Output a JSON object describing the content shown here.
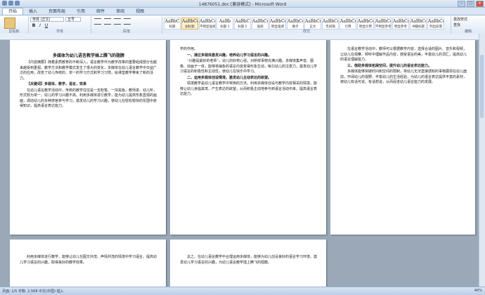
{
  "window": {
    "title": "14876051.doc [兼容模式] - Microsoft Word",
    "close_glyph": "✕",
    "max_glyph": "□",
    "min_glyph": "–"
  },
  "tabs": [
    "开始",
    "插入",
    "页面布局",
    "引用",
    "邮件",
    "审阅",
    "视图"
  ],
  "ribbon": {
    "font_name": "宋体 (正文)",
    "font_size": "五号",
    "bold": "B",
    "italic": "I",
    "underline": "U",
    "groups": {
      "clipboard": "剪贴板",
      "font": "字体",
      "paragraph": "段落",
      "styles": "样式",
      "editing": "编辑"
    },
    "styles": [
      {
        "preview": "AaBbC",
        "label": "标题",
        "selected": false
      },
      {
        "preview": "AaBbCcD",
        "label": "副标题",
        "selected": true
      },
      {
        "preview": "AaBbCcD",
        "label": "不明显强调",
        "selected": false
      },
      {
        "preview": "AaBb",
        "label": "标题 1",
        "selected": false
      },
      {
        "preview": "AaBbC",
        "label": "标题 2",
        "selected": false
      },
      {
        "preview": "AaBbCcD",
        "label": "强调",
        "selected": false
      },
      {
        "preview": "AaBbCcD",
        "label": "明显强调",
        "selected": false
      },
      {
        "preview": "AaBbCcD",
        "label": "要点",
        "selected": false
      },
      {
        "preview": "AaBbCcD",
        "label": "正文",
        "selected": false
      },
      {
        "preview": "AaBbCcD",
        "label": "无间隔",
        "selected": false
      },
      {
        "preview": "AaBbCcD",
        "label": "引用",
        "selected": false
      },
      {
        "preview": "AaBbCcD",
        "label": "明显引用",
        "selected": false
      },
      {
        "preview": "AaBbCcD",
        "label": "不明显参考",
        "selected": false
      },
      {
        "preview": "AaBbCcD",
        "label": "明显参考",
        "selected": false
      },
      {
        "preview": "AaBbCcD",
        "label": "书籍标题",
        "selected": false
      },
      {
        "preview": "AaBbCcD",
        "label": "列出段落",
        "selected": false
      }
    ],
    "change_styles": "更改样式",
    "editing_items": [
      "查找",
      "替换",
      "选择"
    ]
  },
  "pages": [
    {
      "title": "多媒体为幼儿语言教学插上腾飞的翅膀",
      "paragraphs": [
        "【内容摘要】随着素质教育的不断深入，语言教学作为教学改革的重要组成部分也越来越受到重视。教学方法和教学模式发生了很大的变化，多媒体在幼儿语言教学中日益广泛的应用，改变了幼儿传统的、单一的学习方式和学习习惯，给课堂教学带来了新的活力。",
        "【关键词】多媒体，教学，语言，效果",
        "在幼儿语言教学活动中，传统的教学往往是一支粉笔、一块黑板，教师讲、幼儿听，形式较为单一，幼儿的学习兴趣不高。利用多媒体进行教学，能为幼儿提供形象直观的画面，调动幼儿的多种感官参与学习，激发幼儿的学习兴趣，使幼儿在轻松愉快的氛围中获得知识，提高语言表达能力。"
      ]
    },
    {
      "paragraphs": [
        "学的作用。",
        "一、通过多媒体激发兴趣，培养幼儿学习语言的兴趣。",
        "“兴趣是最好的老师”，幼儿的好奇心强，对新鲜事物充满兴趣。多媒体集声音、图像、动画于一体，能够将抽象的语言内容变得形象生动，吸引幼儿的注意力，激发幼儿学习语言的积极性和主动性，使幼儿在快乐中学习。",
        "二、运用多媒体创设情境，激发幼儿主动表达的欲望。",
        "情境教学是幼儿语言教学中常用的方法。利用多媒体创设与教学内容相关的情境，能够让幼儿身临其境，产生表达的欲望，从而积极主动地参与到语言活动中来，提高语言表达能力。"
      ]
    },
    {
      "paragraphs": [
        "在语言教学活动中，教师可以根据教学内容，选择合适的图片、音乐和视频，让幼儿在观察、倾听中理解作品内容，感受语言的美，丰富幼儿的词汇，提高幼儿的语言理解能力。",
        "三、借助多媒体拓展空间，提升幼儿的语言表达能力。",
        "多媒体能够突破时间和空间的限制，将幼儿无法直接感知的事物展现在幼儿面前，开阔幼儿的视野，丰富幼儿的生活经验，为幼儿的语言表达提供丰富的素材，使幼儿有话可说、有话想说，从而促进幼儿语言能力的发展。"
      ]
    },
    {
      "paragraphs": [
        "利用多媒体进行教学，能够让幼儿在图文并茂、声情并茂的情境中学习语言，提高幼儿学习语言的兴趣，取得良好的教学效果。"
      ]
    },
    {
      "paragraphs": [
        "总之，在幼儿语言教学中合理运用多媒体，能够为幼儿创设良好的语言学习环境，激发幼儿学习语言的兴趣，为幼儿语言教学插上腾飞的翅膀。"
      ]
    }
  ],
  "status": {
    "left": "页面: 1/5   字数: 2,568   中文(中国)   插入",
    "zoom": "40%"
  }
}
